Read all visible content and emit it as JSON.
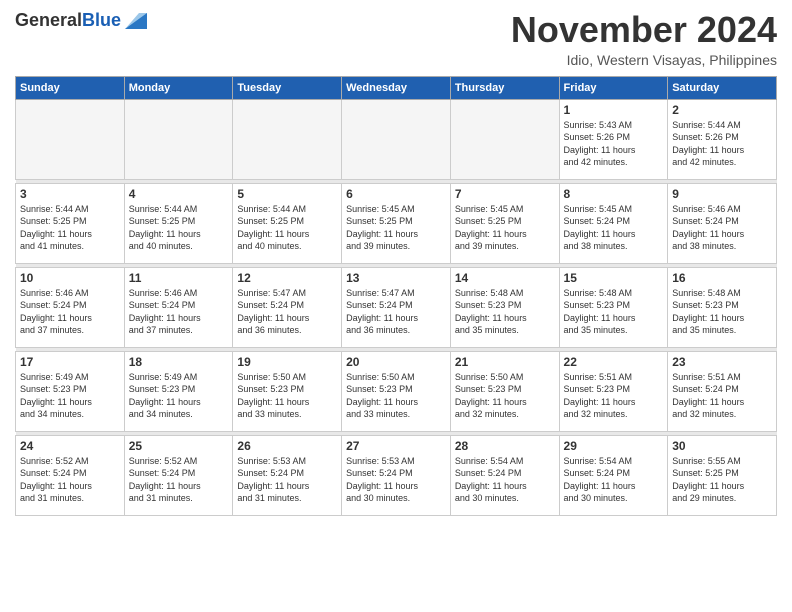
{
  "header": {
    "logo_general": "General",
    "logo_blue": "Blue",
    "title": "November 2024",
    "subtitle": "Idio, Western Visayas, Philippines"
  },
  "weekdays": [
    "Sunday",
    "Monday",
    "Tuesday",
    "Wednesday",
    "Thursday",
    "Friday",
    "Saturday"
  ],
  "weeks": [
    {
      "days": [
        {
          "num": "",
          "info": ""
        },
        {
          "num": "",
          "info": ""
        },
        {
          "num": "",
          "info": ""
        },
        {
          "num": "",
          "info": ""
        },
        {
          "num": "",
          "info": ""
        },
        {
          "num": "1",
          "info": "Sunrise: 5:43 AM\nSunset: 5:26 PM\nDaylight: 11 hours\nand 42 minutes."
        },
        {
          "num": "2",
          "info": "Sunrise: 5:44 AM\nSunset: 5:26 PM\nDaylight: 11 hours\nand 42 minutes."
        }
      ]
    },
    {
      "days": [
        {
          "num": "3",
          "info": "Sunrise: 5:44 AM\nSunset: 5:25 PM\nDaylight: 11 hours\nand 41 minutes."
        },
        {
          "num": "4",
          "info": "Sunrise: 5:44 AM\nSunset: 5:25 PM\nDaylight: 11 hours\nand 40 minutes."
        },
        {
          "num": "5",
          "info": "Sunrise: 5:44 AM\nSunset: 5:25 PM\nDaylight: 11 hours\nand 40 minutes."
        },
        {
          "num": "6",
          "info": "Sunrise: 5:45 AM\nSunset: 5:25 PM\nDaylight: 11 hours\nand 39 minutes."
        },
        {
          "num": "7",
          "info": "Sunrise: 5:45 AM\nSunset: 5:25 PM\nDaylight: 11 hours\nand 39 minutes."
        },
        {
          "num": "8",
          "info": "Sunrise: 5:45 AM\nSunset: 5:24 PM\nDaylight: 11 hours\nand 38 minutes."
        },
        {
          "num": "9",
          "info": "Sunrise: 5:46 AM\nSunset: 5:24 PM\nDaylight: 11 hours\nand 38 minutes."
        }
      ]
    },
    {
      "days": [
        {
          "num": "10",
          "info": "Sunrise: 5:46 AM\nSunset: 5:24 PM\nDaylight: 11 hours\nand 37 minutes."
        },
        {
          "num": "11",
          "info": "Sunrise: 5:46 AM\nSunset: 5:24 PM\nDaylight: 11 hours\nand 37 minutes."
        },
        {
          "num": "12",
          "info": "Sunrise: 5:47 AM\nSunset: 5:24 PM\nDaylight: 11 hours\nand 36 minutes."
        },
        {
          "num": "13",
          "info": "Sunrise: 5:47 AM\nSunset: 5:24 PM\nDaylight: 11 hours\nand 36 minutes."
        },
        {
          "num": "14",
          "info": "Sunrise: 5:48 AM\nSunset: 5:23 PM\nDaylight: 11 hours\nand 35 minutes."
        },
        {
          "num": "15",
          "info": "Sunrise: 5:48 AM\nSunset: 5:23 PM\nDaylight: 11 hours\nand 35 minutes."
        },
        {
          "num": "16",
          "info": "Sunrise: 5:48 AM\nSunset: 5:23 PM\nDaylight: 11 hours\nand 35 minutes."
        }
      ]
    },
    {
      "days": [
        {
          "num": "17",
          "info": "Sunrise: 5:49 AM\nSunset: 5:23 PM\nDaylight: 11 hours\nand 34 minutes."
        },
        {
          "num": "18",
          "info": "Sunrise: 5:49 AM\nSunset: 5:23 PM\nDaylight: 11 hours\nand 34 minutes."
        },
        {
          "num": "19",
          "info": "Sunrise: 5:50 AM\nSunset: 5:23 PM\nDaylight: 11 hours\nand 33 minutes."
        },
        {
          "num": "20",
          "info": "Sunrise: 5:50 AM\nSunset: 5:23 PM\nDaylight: 11 hours\nand 33 minutes."
        },
        {
          "num": "21",
          "info": "Sunrise: 5:50 AM\nSunset: 5:23 PM\nDaylight: 11 hours\nand 32 minutes."
        },
        {
          "num": "22",
          "info": "Sunrise: 5:51 AM\nSunset: 5:23 PM\nDaylight: 11 hours\nand 32 minutes."
        },
        {
          "num": "23",
          "info": "Sunrise: 5:51 AM\nSunset: 5:24 PM\nDaylight: 11 hours\nand 32 minutes."
        }
      ]
    },
    {
      "days": [
        {
          "num": "24",
          "info": "Sunrise: 5:52 AM\nSunset: 5:24 PM\nDaylight: 11 hours\nand 31 minutes."
        },
        {
          "num": "25",
          "info": "Sunrise: 5:52 AM\nSunset: 5:24 PM\nDaylight: 11 hours\nand 31 minutes."
        },
        {
          "num": "26",
          "info": "Sunrise: 5:53 AM\nSunset: 5:24 PM\nDaylight: 11 hours\nand 31 minutes."
        },
        {
          "num": "27",
          "info": "Sunrise: 5:53 AM\nSunset: 5:24 PM\nDaylight: 11 hours\nand 30 minutes."
        },
        {
          "num": "28",
          "info": "Sunrise: 5:54 AM\nSunset: 5:24 PM\nDaylight: 11 hours\nand 30 minutes."
        },
        {
          "num": "29",
          "info": "Sunrise: 5:54 AM\nSunset: 5:24 PM\nDaylight: 11 hours\nand 30 minutes."
        },
        {
          "num": "30",
          "info": "Sunrise: 5:55 AM\nSunset: 5:25 PM\nDaylight: 11 hours\nand 29 minutes."
        }
      ]
    }
  ]
}
